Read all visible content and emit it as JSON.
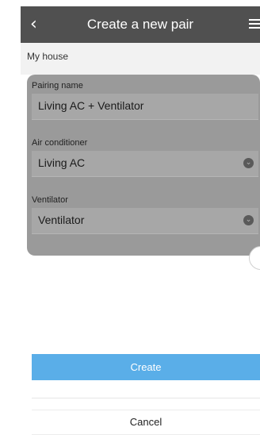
{
  "header": {
    "back_icon": "chevron-left-icon",
    "title": "Create a new pair",
    "menu_icon": "hamburger-menu-icon"
  },
  "subheader": {
    "house": "My house"
  },
  "form": {
    "pairing_name": {
      "label": "Pairing name",
      "value": "Living AC + Ventilator"
    },
    "air_conditioner": {
      "label": "Air conditioner",
      "value": "Living AC",
      "icon": "chevron-down-icon"
    },
    "ventilator": {
      "label": "Ventilator",
      "value": "Ventilator",
      "icon": "chevron-down-icon"
    }
  },
  "actions": {
    "create_label": "Create",
    "cancel_label": "Cancel"
  },
  "colors": {
    "header": "#505050",
    "card": "#9a9a9a",
    "accent": "#5aaee8"
  }
}
